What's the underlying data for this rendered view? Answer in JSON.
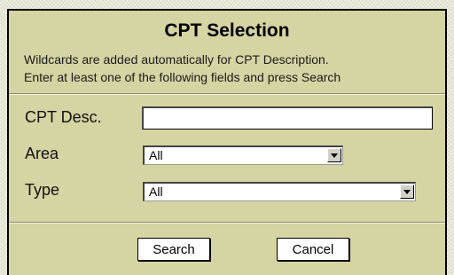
{
  "form": {
    "title": "CPT Selection",
    "instructions": [
      "Wildcards are added automatically for CPT Description.",
      "Enter at least one of the following fields and press Search"
    ],
    "fields": {
      "cpt_desc": {
        "label": "CPT Desc.",
        "value": ""
      },
      "area": {
        "label": "Area",
        "selected": "All"
      },
      "type": {
        "label": "Type",
        "selected": "All"
      }
    },
    "buttons": {
      "search": "Search",
      "cancel": "Cancel"
    }
  },
  "icons": {
    "dropdown": "chevron-down-icon"
  },
  "colors": {
    "panel": "#d5d4a3",
    "page": "#efefe0"
  }
}
